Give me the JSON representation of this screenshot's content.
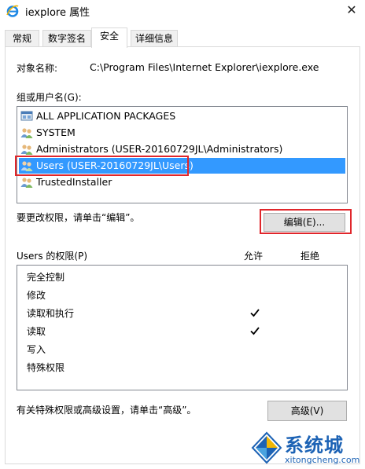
{
  "window": {
    "title": "iexplore 属性",
    "icon": "internet-explorer-icon",
    "close_glyph": "✕"
  },
  "tabs": [
    {
      "label": "常规"
    },
    {
      "label": "数字签名"
    },
    {
      "label": "安全",
      "active": true
    },
    {
      "label": "详细信息"
    }
  ],
  "security": {
    "object_name_label": "对象名称:",
    "object_name_value": "C:\\Program Files\\Internet Explorer\\iexplore.exe",
    "groups_label": "组或用户名(G):",
    "groups": [
      {
        "name": "ALL APPLICATION PACKAGES",
        "icon": "app-packages-icon"
      },
      {
        "name": "SYSTEM",
        "icon": "users-group-icon"
      },
      {
        "name": "Administrators (USER-20160729JL\\Administrators)",
        "icon": "users-group-icon"
      },
      {
        "name": "Users (USER-20160729JL\\Users)",
        "icon": "users-group-icon",
        "selected": true
      },
      {
        "name": "TrustedInstaller",
        "icon": "users-group-icon"
      }
    ],
    "change_hint": "要更改权限，请单击“编辑”。",
    "edit_button": "编辑(E)...",
    "perms_label": "Users 的权限(P)",
    "allow_header": "允许",
    "deny_header": "拒绝",
    "permissions": [
      {
        "name": "完全控制",
        "allow": false,
        "deny": false
      },
      {
        "name": "修改",
        "allow": false,
        "deny": false
      },
      {
        "name": "读取和执行",
        "allow": true,
        "deny": false
      },
      {
        "name": "读取",
        "allow": true,
        "deny": false
      },
      {
        "name": "写入",
        "allow": false,
        "deny": false
      },
      {
        "name": "特殊权限",
        "allow": false,
        "deny": false
      }
    ],
    "advanced_hint": "有关特殊权限或高级设置，请单击“高级”。",
    "advanced_button": "高级(V)"
  },
  "watermark": {
    "cn": "系统城",
    "en": "xitongcheng.com"
  },
  "colors": {
    "selection": "#3399ff",
    "highlight_box": "#e0262b",
    "watermark": "#1d63b5"
  }
}
